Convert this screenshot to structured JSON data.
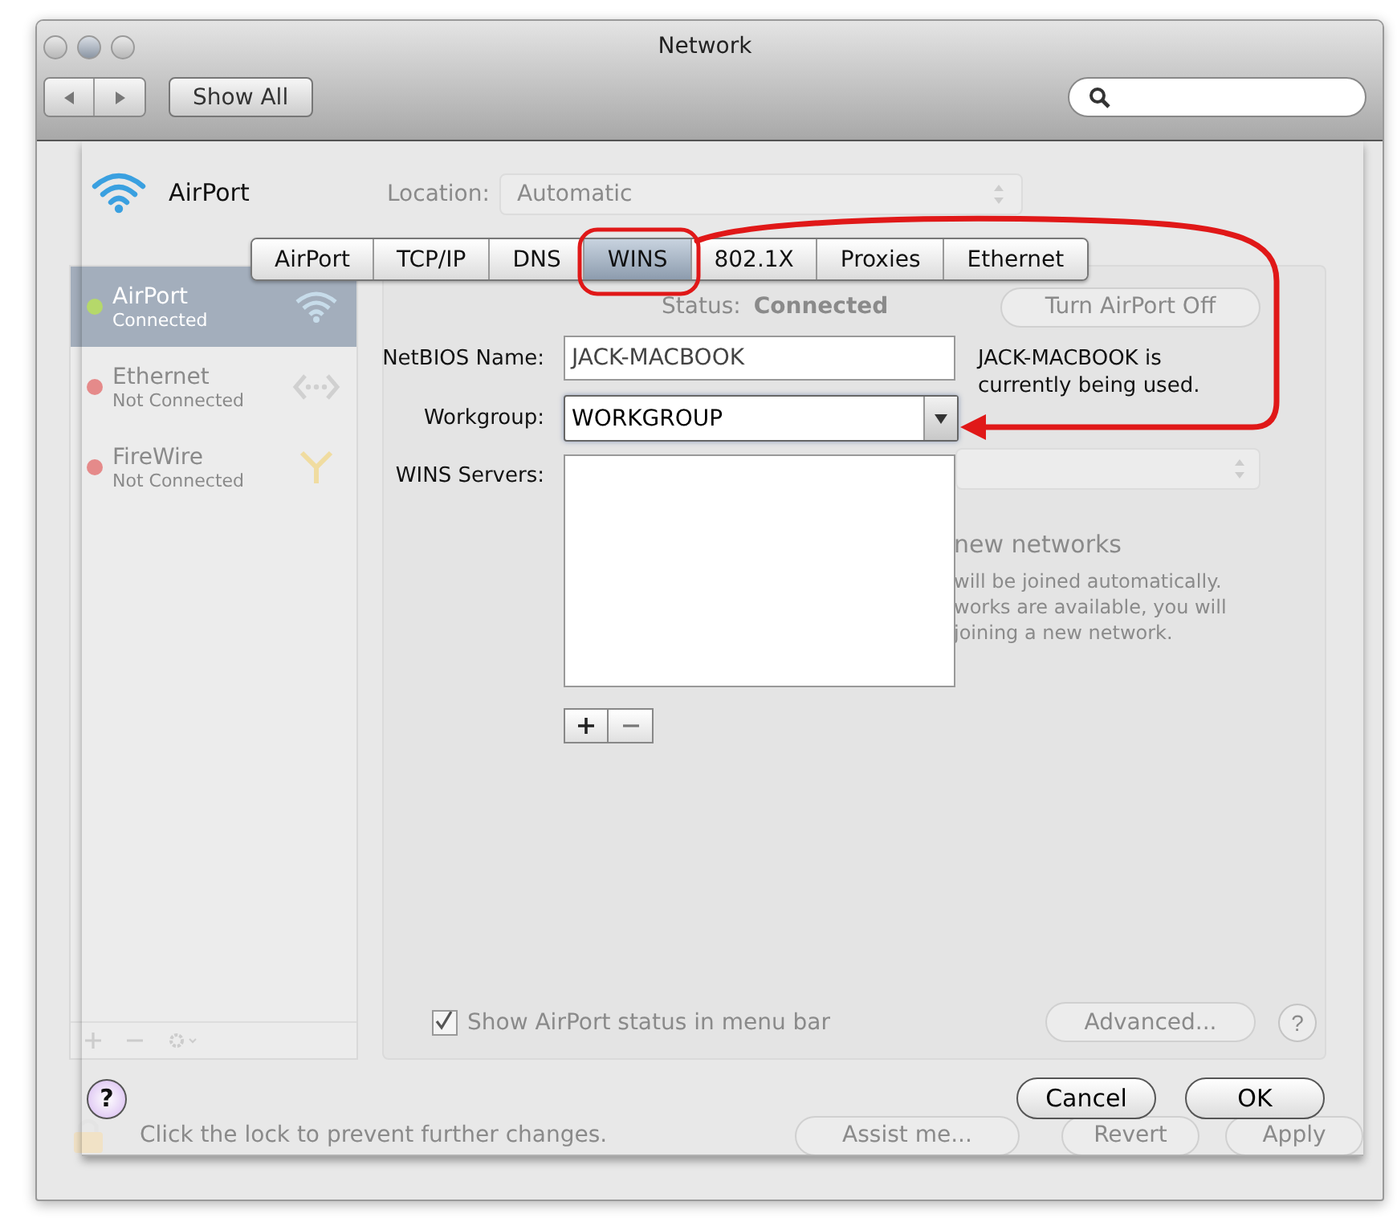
{
  "window": {
    "title": "Network",
    "show_all": "Show All"
  },
  "location": {
    "label": "Location:",
    "value": "Automatic"
  },
  "services": [
    {
      "name": "AirPort",
      "status": "Connected",
      "selected": true,
      "color": "#b5d86a",
      "kind": "wifi"
    },
    {
      "name": "Ethernet",
      "status": "Not Connected",
      "selected": false,
      "color": "#e58a8a",
      "kind": "ethernet"
    },
    {
      "name": "FireWire",
      "status": "Not Connected",
      "selected": false,
      "color": "#e58a8a",
      "kind": "firewire"
    }
  ],
  "status": {
    "label": "Status:",
    "value": "Connected",
    "button": "Turn AirPort Off"
  },
  "network_text": {
    "heading": "new networks",
    "lines": [
      "will be joined automatically.",
      "works are available, you will",
      "joining a new network."
    ]
  },
  "menu_bar_checkbox": {
    "label": "Show AirPort status in menu bar",
    "checked": true
  },
  "advanced_button": "Advanced...",
  "panel_help": "?",
  "lock_text": "Click the lock to prevent further changes.",
  "assist_button": "Assist me...",
  "revert_button": "Revert",
  "apply_button": "Apply",
  "sheet": {
    "service": "AirPort",
    "tabs": [
      {
        "label": "AirPort",
        "selected": false
      },
      {
        "label": "TCP/IP",
        "selected": false
      },
      {
        "label": "DNS",
        "selected": false
      },
      {
        "label": "WINS",
        "selected": true
      },
      {
        "label": "802.1X",
        "selected": false
      },
      {
        "label": "Proxies",
        "selected": false
      },
      {
        "label": "Ethernet",
        "selected": false
      }
    ],
    "netbios": {
      "label": "NetBIOS Name:",
      "value": "JACK-MACBOOK"
    },
    "note": "JACK-MACBOOK is currently being used.",
    "workgroup": {
      "label": "Workgroup:",
      "value": "WORKGROUP"
    },
    "wins_servers": {
      "label": "WINS Servers:"
    },
    "help": "?",
    "cancel_button": "Cancel",
    "ok_button": "OK"
  }
}
